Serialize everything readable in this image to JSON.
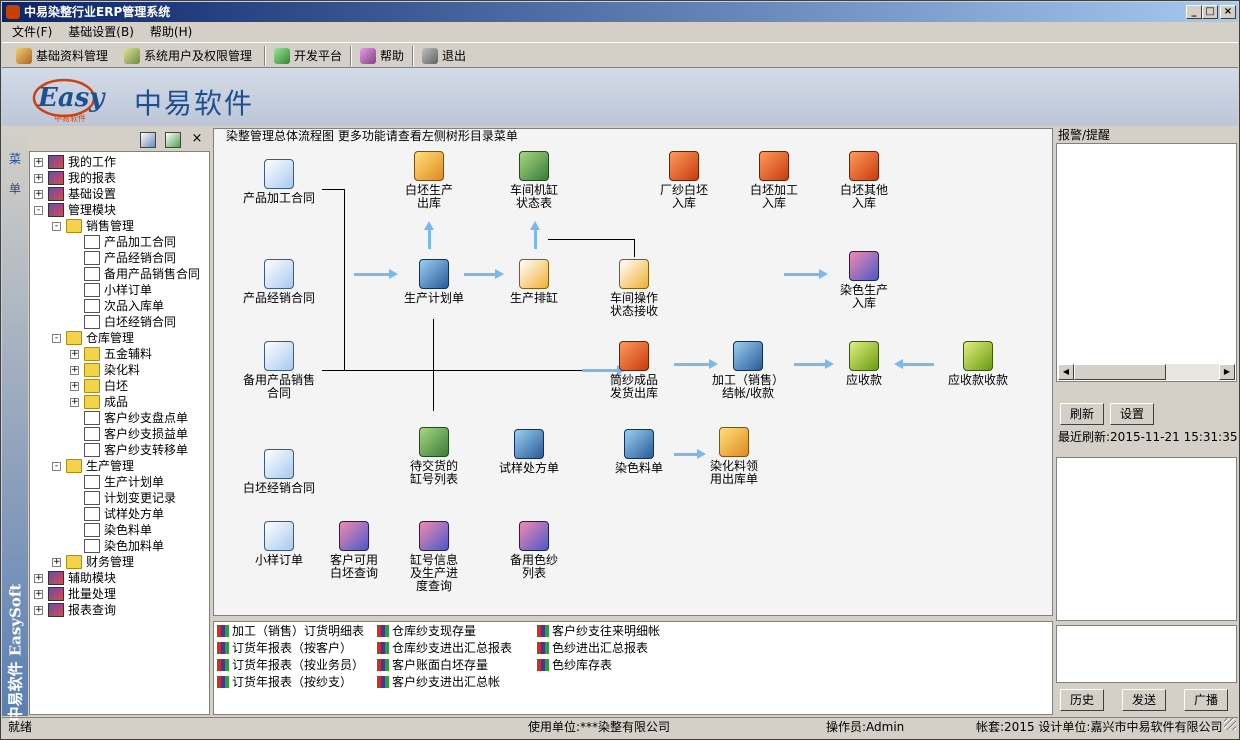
{
  "window": {
    "title": "中易染整行业ERP管理系统",
    "controls": {
      "minimize": "_",
      "maximize": "□",
      "close": "×"
    }
  },
  "menu": {
    "items": [
      "文件(F)",
      "基础设置(B)",
      "帮助(H)"
    ]
  },
  "toolbar": {
    "items": [
      {
        "label": "基础资料管理",
        "icon": "building-icon"
      },
      {
        "label": "系统用户及权限管理",
        "icon": "users-icon"
      },
      {
        "label": "开发平台",
        "icon": "pencil-icon"
      },
      {
        "label": "帮助",
        "icon": "book-icon"
      },
      {
        "label": "退出",
        "icon": "exit-icon"
      }
    ]
  },
  "banner": {
    "logo_text": "Easy",
    "logo_sub": "中易软件",
    "brand": "中易软件"
  },
  "sidebar_strip": {
    "top": "菜单",
    "bottom": "中易软件 EasySoft"
  },
  "tree": {
    "nodes": [
      {
        "label": "我的工作",
        "depth": 0,
        "pm": "+",
        "icon": "mod"
      },
      {
        "label": "我的报表",
        "depth": 0,
        "pm": "+",
        "icon": "mod"
      },
      {
        "label": "基础设置",
        "depth": 0,
        "pm": "+",
        "icon": "mod"
      },
      {
        "label": "管理模块",
        "depth": 0,
        "pm": "-",
        "icon": "mod"
      },
      {
        "label": "销售管理",
        "depth": 1,
        "pm": "-",
        "icon": "folder"
      },
      {
        "label": "产品加工合同",
        "depth": 2,
        "pm": "",
        "icon": "doc"
      },
      {
        "label": "产品经销合同",
        "depth": 2,
        "pm": "",
        "icon": "doc"
      },
      {
        "label": "备用产品销售合同",
        "depth": 2,
        "pm": "",
        "icon": "doc"
      },
      {
        "label": "小样订单",
        "depth": 2,
        "pm": "",
        "icon": "doc"
      },
      {
        "label": "次品入库单",
        "depth": 2,
        "pm": "",
        "icon": "doc"
      },
      {
        "label": "白坯经销合同",
        "depth": 2,
        "pm": "",
        "icon": "doc"
      },
      {
        "label": "仓库管理",
        "depth": 1,
        "pm": "-",
        "icon": "folder"
      },
      {
        "label": "五金辅料",
        "depth": 2,
        "pm": "+",
        "icon": "folder"
      },
      {
        "label": "染化料",
        "depth": 2,
        "pm": "+",
        "icon": "folder"
      },
      {
        "label": "白坯",
        "depth": 2,
        "pm": "+",
        "icon": "folder"
      },
      {
        "label": "成品",
        "depth": 2,
        "pm": "+",
        "icon": "folder"
      },
      {
        "label": "客户纱支盘点单",
        "depth": 2,
        "pm": "",
        "icon": "doc"
      },
      {
        "label": "客户纱支损益单",
        "depth": 2,
        "pm": "",
        "icon": "doc"
      },
      {
        "label": "客户纱支转移单",
        "depth": 2,
        "pm": "",
        "icon": "doc"
      },
      {
        "label": "生产管理",
        "depth": 1,
        "pm": "-",
        "icon": "folder"
      },
      {
        "label": "生产计划单",
        "depth": 2,
        "pm": "",
        "icon": "doc"
      },
      {
        "label": "计划变更记录",
        "depth": 2,
        "pm": "",
        "icon": "doc"
      },
      {
        "label": "试样处方单",
        "depth": 2,
        "pm": "",
        "icon": "doc"
      },
      {
        "label": "染色料单",
        "depth": 2,
        "pm": "",
        "icon": "doc"
      },
      {
        "label": "染色加料单",
        "depth": 2,
        "pm": "",
        "icon": "doc"
      },
      {
        "label": "财务管理",
        "depth": 1,
        "pm": "+",
        "icon": "folder"
      },
      {
        "label": "辅助模块",
        "depth": 0,
        "pm": "+",
        "icon": "mod"
      },
      {
        "label": "批量处理",
        "depth": 0,
        "pm": "+",
        "icon": "mod"
      },
      {
        "label": "报表查询",
        "depth": 0,
        "pm": "+",
        "icon": "mod"
      }
    ]
  },
  "flow": {
    "caption": "染整管理总体流程图    更多功能请查看左侧树形目录菜单",
    "items": [
      {
        "name": "contract-processing",
        "label": "产品加工合同",
        "icon": "doc"
      },
      {
        "name": "contract-distribution",
        "label": "产品经销合同",
        "icon": "doc"
      },
      {
        "name": "contract-spare",
        "label": "备用产品销售\n合同",
        "icon": "doc"
      },
      {
        "name": "contract-greige",
        "label": "白坯经销合同",
        "icon": "doc"
      },
      {
        "name": "sample-order",
        "label": "小样订单",
        "icon": "doc"
      },
      {
        "name": "greige-outbound",
        "label": "白坯生产\n出库",
        "icon": "box"
      },
      {
        "name": "vat-status",
        "label": "车间机缸\n状态表",
        "icon": "grid"
      },
      {
        "name": "production-plan",
        "label": "生产计划单",
        "icon": "calc"
      },
      {
        "name": "production-vat",
        "label": "生产排缸",
        "icon": "gear"
      },
      {
        "name": "workshop-status",
        "label": "车间操作\n状态接收",
        "icon": "gear"
      },
      {
        "name": "mill-yarn-inbound",
        "label": "厂纱白坯\n入库",
        "icon": "truck"
      },
      {
        "name": "greige-process-inbound",
        "label": "白坯加工\n入库",
        "icon": "truck"
      },
      {
        "name": "greige-other-inbound",
        "label": "白坯其他\n入库",
        "icon": "truck"
      },
      {
        "name": "dye-production-inbound",
        "label": "染色生产\n入库",
        "icon": "ppl"
      },
      {
        "name": "finished-shipment",
        "label": "筒纱成品\n发货出库",
        "icon": "truck"
      },
      {
        "name": "billing",
        "label": "加工（销售）\n结帐/收款",
        "icon": "calc"
      },
      {
        "name": "receivable",
        "label": "应收款",
        "icon": "bag"
      },
      {
        "name": "receivable-collect",
        "label": "应收款收款",
        "icon": "bag"
      },
      {
        "name": "pending-vat-list",
        "label": "待交货的\n缸号列表",
        "icon": "grid"
      },
      {
        "name": "trial-recipe",
        "label": "试样处方单",
        "icon": "calc"
      },
      {
        "name": "dye-material",
        "label": "染色料单",
        "icon": "calc"
      },
      {
        "name": "dye-outbound",
        "label": "染化料领\n用出库单",
        "icon": "box"
      },
      {
        "name": "customer-greige-query",
        "label": "客户可用\n白坯查询",
        "icon": "ppl"
      },
      {
        "name": "vat-progress-query",
        "label": "缸号信息\n及生产进\n度查询",
        "icon": "ppl"
      },
      {
        "name": "spare-yarn-list",
        "label": "备用色纱\n列表",
        "icon": "ppl"
      }
    ]
  },
  "reports": {
    "items": [
      "加工（销售）订货明细表",
      "订货年报表（按客户）",
      "订货年报表（按业务员）",
      "订货年报表（按纱支）",
      "仓库纱支现存量",
      "仓库纱支进出汇总报表",
      "客户账面白坯存量",
      "客户纱支进出汇总帐",
      "客户纱支往来明细帐",
      "色纱进出汇总报表",
      "色纱库存表"
    ]
  },
  "right": {
    "alarm_label": "报警/提醒",
    "refresh": "刷新",
    "settings": "设置",
    "last_refresh": "最近刷新:2015-11-21 15:31:35",
    "history": "历史",
    "send": "发送",
    "broadcast": "广播"
  },
  "status": {
    "ready": "就绪",
    "company": "使用单位:***染整有限公司",
    "operator": "操作员:Admin",
    "account": "帐套:2015 设计单位:嘉兴市中易软件有限公司"
  }
}
